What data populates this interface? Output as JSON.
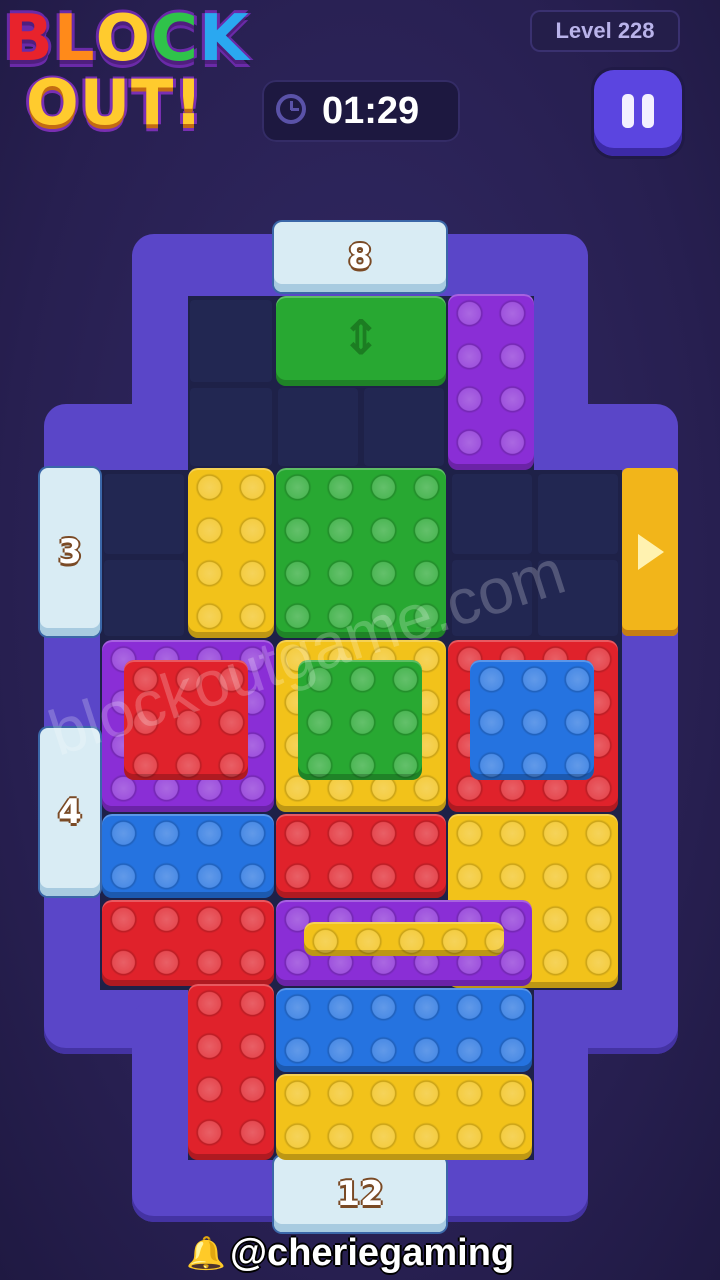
{
  "header": {
    "logo_line1": [
      "B",
      "L",
      "O",
      "C",
      "K"
    ],
    "logo_line1_colors": [
      "#e8232c",
      "#ff8a1a",
      "#ffcb2e",
      "#2fc34a",
      "#2aa8f0"
    ],
    "logo_line2": "OUT!",
    "level_label": "Level 228",
    "timer_value": "01:29",
    "clock_icon": "clock-icon",
    "pause_icon": "pause-icon"
  },
  "gates": {
    "top": "8",
    "left_upper": "3",
    "left_lower": "4",
    "bottom": "12"
  },
  "pieces": {
    "colors": {
      "yellow": "#f2c21a",
      "green": "#28a832",
      "purple": "#8a2ed6",
      "red": "#e0222b",
      "blue": "#2573e0",
      "wall": "#5a46c8",
      "gate": "#d9ecf4"
    }
  },
  "watermark": "blockoutgame.com",
  "credit": "@cheriegaming",
  "credit_icon": "bell-icon"
}
